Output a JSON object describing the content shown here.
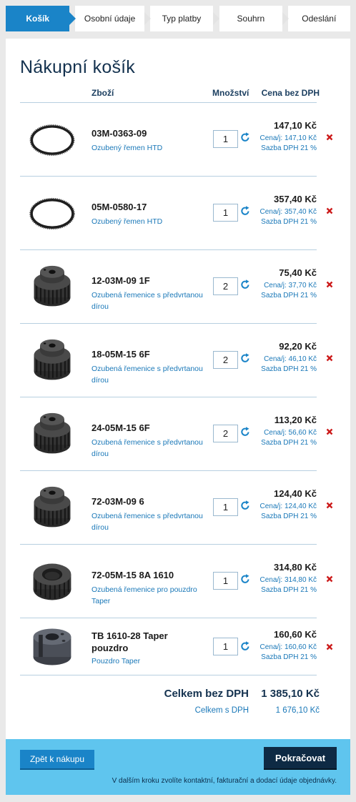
{
  "steps": [
    {
      "label": "Košík",
      "active": true
    },
    {
      "label": "Osobní údaje",
      "active": false
    },
    {
      "label": "Typ platby",
      "active": false
    },
    {
      "label": "Souhrn",
      "active": false
    },
    {
      "label": "Odeslání",
      "active": false
    }
  ],
  "page": {
    "title": "Nákupní košík"
  },
  "table": {
    "headers": {
      "goods": "Zboží",
      "quantity": "Množství",
      "price": "Cena bez DPH"
    }
  },
  "items": [
    {
      "code": "03M-0363-09",
      "desc": "Ozubený řemen HTD",
      "qty": "1",
      "price": "147,10 Kč",
      "unit": "Cena/j: 147,10 Kč",
      "vat": "Sazba DPH 21 %",
      "image": "belt-icon"
    },
    {
      "code": "05M-0580-17",
      "desc": "Ozubený řemen HTD",
      "qty": "1",
      "price": "357,40 Kč",
      "unit": "Cena/j: 357,40 Kč",
      "vat": "Sazba DPH 21 %",
      "image": "belt-icon"
    },
    {
      "code": "12-03M-09 1F",
      "desc": "Ozubená řemenice s předvrtanou dírou",
      "qty": "2",
      "price": "75,40 Kč",
      "unit": "Cena/j: 37,70 Kč",
      "vat": "Sazba DPH 21 %",
      "image": "pulley-icon"
    },
    {
      "code": "18-05M-15 6F",
      "desc": "Ozubená řemenice s předvrtanou dírou",
      "qty": "2",
      "price": "92,20 Kč",
      "unit": "Cena/j: 46,10 Kč",
      "vat": "Sazba DPH 21 %",
      "image": "pulley-icon"
    },
    {
      "code": "24-05M-15 6F",
      "desc": "Ozubená řemenice s předvrtanou dírou",
      "qty": "2",
      "price": "113,20 Kč",
      "unit": "Cena/j: 56,60 Kč",
      "vat": "Sazba DPH 21 %",
      "image": "pulley-icon"
    },
    {
      "code": "72-03M-09 6",
      "desc": "Ozubená řemenice s předvrtanou dírou",
      "qty": "1",
      "price": "124,40 Kč",
      "unit": "Cena/j: 124,40 Kč",
      "vat": "Sazba DPH 21 %",
      "image": "pulley-icon"
    },
    {
      "code": "72-05M-15 8A 1610",
      "desc": "Ozubená řemenice pro pouzdro Taper",
      "qty": "1",
      "price": "314,80 Kč",
      "unit": "Cena/j: 314,80 Kč",
      "vat": "Sazba DPH 21 %",
      "image": "taper-pulley-icon"
    },
    {
      "code": "TB 1610-28 Taper pouzdro",
      "desc": "Pouzdro Taper",
      "qty": "1",
      "price": "160,60 Kč",
      "unit": "Cena/j: 160,60 Kč",
      "vat": "Sazba DPH 21 %",
      "image": "taper-bush-icon"
    }
  ],
  "totals": {
    "net_label": "Celkem bez DPH",
    "net_value": "1 385,10 Kč",
    "gross_label": "Celkem s DPH",
    "gross_value": "1 676,10 Kč"
  },
  "footer": {
    "back_label": "Zpět k nákupu",
    "next_label": "Pokračovat",
    "hint": "V dalším kroku zvolíte kontaktní, fakturační a dodací údaje objednávky."
  },
  "colors": {
    "accent": "#1a84c8",
    "link": "#1a78b8",
    "footer": "#5fc5ee",
    "dark_button": "#0e2a44",
    "remove": "#cc1b1b"
  }
}
